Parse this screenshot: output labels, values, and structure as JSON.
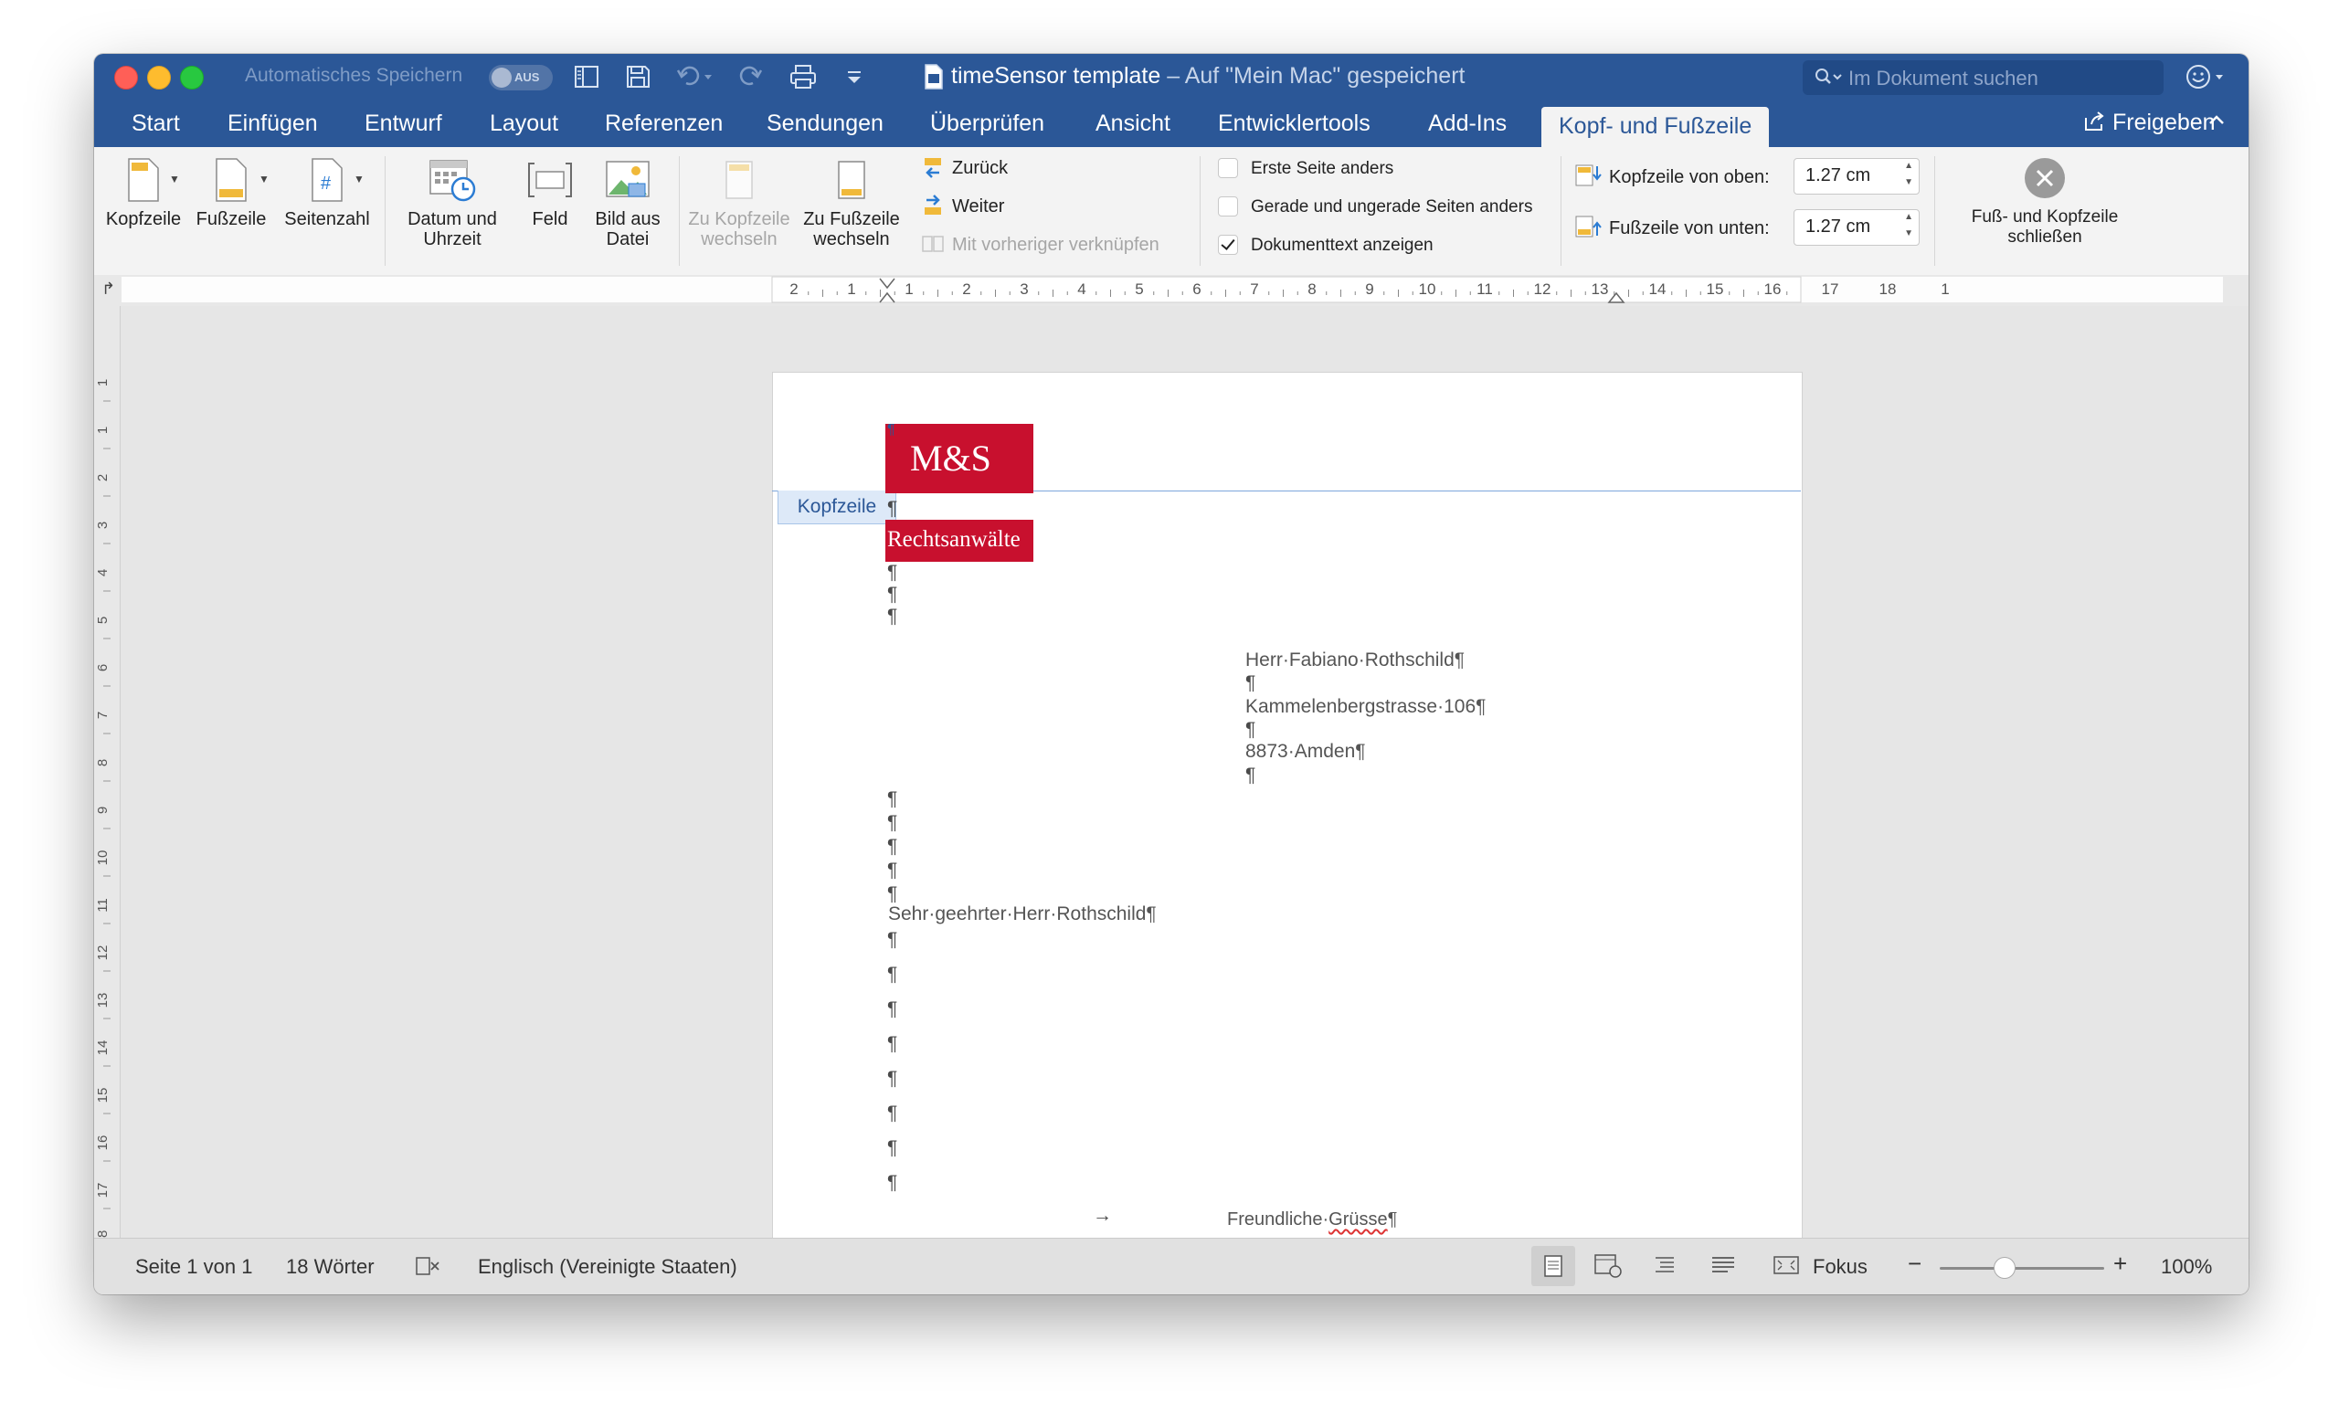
{
  "titlebar": {
    "autosave_label": "Automatisches Speichern",
    "autosave_state": "AUS",
    "doc_title": "timeSensor template",
    "doc_subtitle": " – Auf \"Mein Mac\" gespeichert",
    "search_placeholder": "Im Dokument suchen"
  },
  "tabs": [
    "Start",
    "Einfügen",
    "Entwurf",
    "Layout",
    "Referenzen",
    "Sendungen",
    "Überprüfen",
    "Ansicht",
    "Entwicklertools",
    "Add-Ins",
    "Kopf- und Fußzeile"
  ],
  "share_label": "Freigeben",
  "ribbon": {
    "header_btn": "Kopfzeile",
    "footer_btn": "Fußzeile",
    "pagenum_btn": "Seitenzahl",
    "datetime_btn": [
      "Datum und",
      "Uhrzeit"
    ],
    "field_btn": "Feld",
    "picture_btn": [
      "Bild aus",
      "Datei"
    ],
    "goto_header_btn": [
      "Zu Kopfzeile",
      "wechseln"
    ],
    "goto_footer_btn": [
      "Zu Fußzeile",
      "wechseln"
    ],
    "prev_label": "Zurück",
    "next_label": "Weiter",
    "link_prev_label": "Mit vorheriger verknüpfen",
    "check_first_page": "Erste Seite anders",
    "check_odd_even": "Gerade und ungerade Seiten anders",
    "check_show_text": "Dokumenttext anzeigen",
    "header_from_top_label": "Kopfzeile von oben:",
    "header_from_top_value": "1.27 cm",
    "footer_from_bottom_label": "Fußzeile von unten:",
    "footer_from_bottom_value": "1.27 cm",
    "close_btn": [
      "Fuß- und Kopfzeile",
      "schließen"
    ]
  },
  "ruler_h_labels": [
    "2",
    "1",
    "1",
    "2",
    "3",
    "4",
    "5",
    "6",
    "7",
    "8",
    "9",
    "10",
    "11",
    "12",
    "13",
    "14",
    "15",
    "16",
    "17",
    "18",
    "1"
  ],
  "ruler_v_labels": [
    "1",
    "1",
    "2",
    "3",
    "4",
    "5",
    "6",
    "7",
    "8",
    "9",
    "10",
    "11",
    "12",
    "13",
    "14",
    "15",
    "16",
    "17",
    "18"
  ],
  "document": {
    "header_tag": "Kopfzeile",
    "logo_line1": "M&S",
    "logo_line2": "Rechtsanwälte",
    "pilcrow": "¶",
    "addr_name": "Herr·Fabiano·Rothschild¶",
    "addr_street": "Kammelenbergstrasse·106¶",
    "addr_city": "8873·Amden¶",
    "salutation": "Sehr·geehrter·Herr·Rothschild¶",
    "tab_arrow": "→",
    "closing_word1": "Freundliche·",
    "closing_word2": "Grüsse",
    "closing_mark": "¶"
  },
  "status": {
    "page": "Seite 1 von 1",
    "words": "18 Wörter",
    "language": "Englisch (Vereinigte Staaten)",
    "focus": "Fokus",
    "zoom_minus": "−",
    "zoom_plus": "+",
    "zoom": "100%",
    "zoom_level_percent": 100
  },
  "colors": {
    "titlebar_blue": "#2b5797",
    "logo_red": "#c8102e",
    "header_line": "#7ea6dc"
  }
}
